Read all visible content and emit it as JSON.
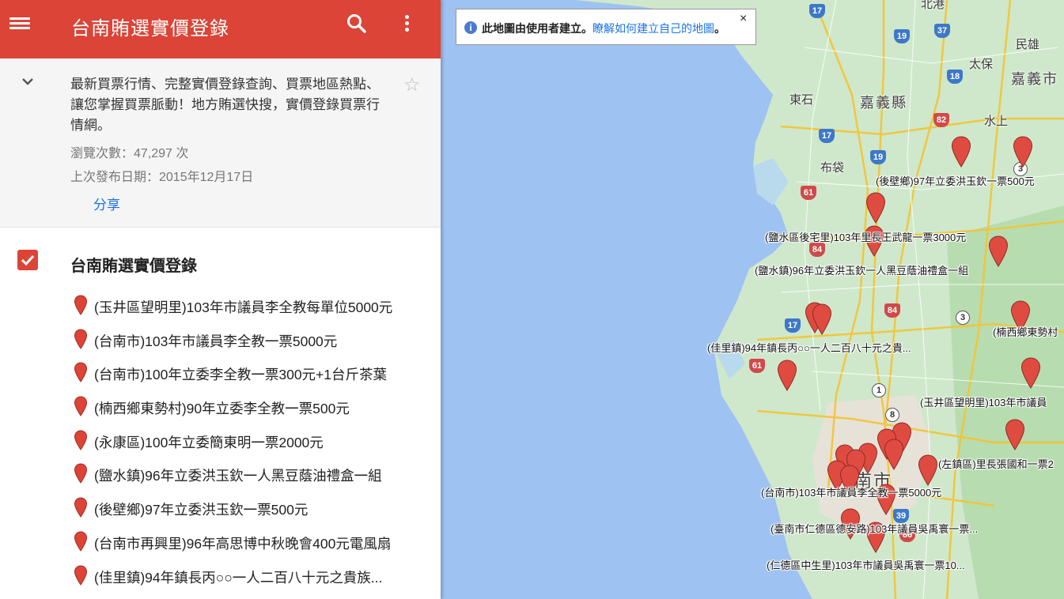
{
  "header": {
    "title": "台南賄選實價登錄"
  },
  "info": {
    "description": "最新買票行情、完整實價登錄查詢、買票地區熱點、讓您掌握買票脈動！地方賄選快搜，實價登錄買票行情網。",
    "views": "瀏覽次數：47,297 次",
    "published": "上次發布日期：2015年12月17日",
    "share_label": "分享"
  },
  "layer": {
    "title": "台南賄選實價登錄",
    "items": [
      {
        "label": "(玉井區望明里)103年市議員李全教每單位5000元"
      },
      {
        "label": "(台南市)103年市議員李全教一票5000元"
      },
      {
        "label": "(台南市)100年立委李全教一票300元+1台斤茶葉"
      },
      {
        "label": "(楠西鄉東勢村)90年立委李全教一票500元"
      },
      {
        "label": "(永康區)100年立委簡東明一票2000元"
      },
      {
        "label": "(鹽水鎮)96年立委洪玉欽一人黑豆蔭油禮盒一組"
      },
      {
        "label": "(後壁鄉)97年立委洪玉欽一票500元"
      },
      {
        "label": "(台南市再興里)96年高思博中秋晚會400元電風扇"
      },
      {
        "label": "(佳里鎮)94年鎮長丙○○一人二百八十元之貴族..."
      }
    ]
  },
  "map": {
    "notice": {
      "text": "此地圖由使用者建立。",
      "link": "瞭解如何建立自己的地圖",
      "suffix": "。",
      "close": "×"
    },
    "places": {
      "beigang": "北港",
      "minxiong": "民雄",
      "taibao": "太保",
      "chiayi_city": "嘉義市",
      "dongshi": "東石",
      "chiayi_county": "嘉義縣",
      "shuishang": "水上",
      "budai": "布袋",
      "tainan_city": "南市"
    },
    "marker_labels": {
      "houbi": "(後壁鄉)97年立委洪玉欽一票500元",
      "yanshui_li": "(鹽水區後宅里)103年里長王武龍一票3000元",
      "yanshui_zhen": "(鹽水鎮)96年立委洪玉欽一人黑豆蔭油禮盒一組",
      "nanxi": "(楠西鄉東勢村",
      "jiali": "(佳里鎮)94年鎮長丙○○一人二百八十元之貴...",
      "yujing": "(玉井區望明里)103年市議員",
      "zuozhen": "(左鎮區)里長張國和一票2",
      "tainan": "(台南市)103年市議員李全教一票5000元",
      "rende_de": "(臺南市仁德區德安路)103年議員吳禹寰一票...",
      "rende_zs": "(仁德區中生里)103年市議員吳禹寰一票10..."
    },
    "route_shields": [
      "17",
      "19",
      "37",
      "18",
      "82",
      "17",
      "19",
      "61",
      "84",
      "84",
      "17",
      "61",
      "3",
      "3",
      "1",
      "8",
      "39",
      "86"
    ],
    "colors": {
      "accent": "#db4437",
      "link": "#1a73e8",
      "sea": "#9ec2f2",
      "land": "#c9e7c8"
    }
  }
}
